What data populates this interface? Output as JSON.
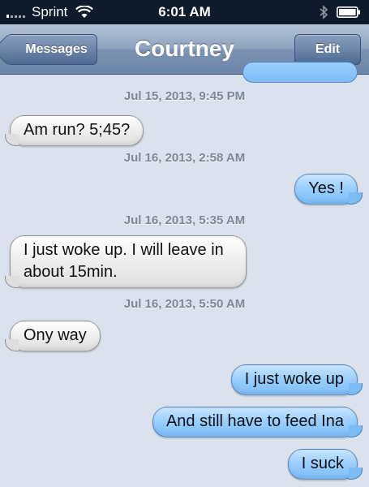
{
  "status_bar": {
    "carrier": "Sprint",
    "time": "6:01 AM",
    "signal_icon": "signal-bars-icon",
    "wifi_icon": "wifi-icon",
    "bluetooth_icon": "bluetooth-icon",
    "battery_icon": "battery-icon"
  },
  "nav": {
    "back_label": "Messages",
    "title": "Courtney",
    "edit_label": "Edit"
  },
  "colors": {
    "incoming_bubble": "#e8e8e8",
    "outgoing_bubble": "#9ccfff",
    "background": "#DBE2ED",
    "timestamp": "#7d8896"
  },
  "messages": [
    {
      "type": "timestamp",
      "text": "Jul 15, 2013, 9:45 PM"
    },
    {
      "type": "incoming",
      "text": "Am run? 5;45?"
    },
    {
      "type": "timestamp",
      "text": "Jul 16, 2013, 2:58 AM"
    },
    {
      "type": "outgoing",
      "text": "Yes !"
    },
    {
      "type": "timestamp",
      "text": "Jul 16, 2013, 5:35 AM"
    },
    {
      "type": "incoming",
      "text": "I just woke up. I will leave in about 15min."
    },
    {
      "type": "timestamp",
      "text": "Jul 16, 2013, 5:50 AM"
    },
    {
      "type": "incoming",
      "text": "Ony way"
    },
    {
      "type": "outgoing",
      "text": "I just woke up"
    },
    {
      "type": "outgoing",
      "text": "And still have to feed Ina"
    },
    {
      "type": "outgoing",
      "text": "I suck"
    }
  ]
}
